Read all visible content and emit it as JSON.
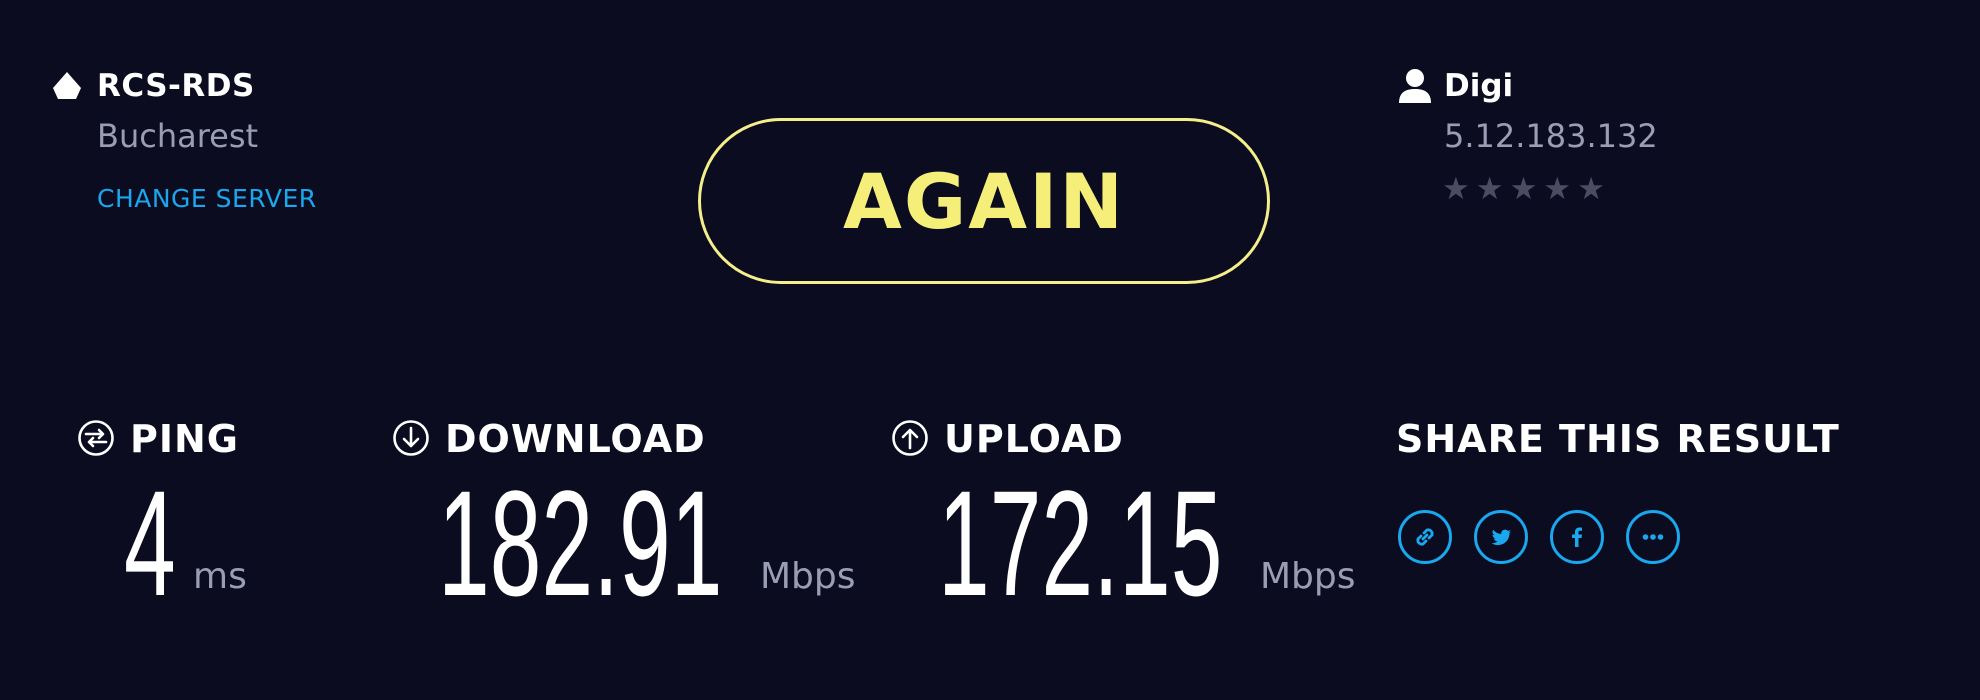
{
  "server": {
    "name": "RCS-RDS",
    "city": "Bucharest",
    "change_label": "CHANGE SERVER",
    "icon": "server-icon"
  },
  "action": {
    "again_label": "AGAIN"
  },
  "isp": {
    "name": "Digi",
    "ip": "5.12.183.132",
    "rating": 0,
    "rating_max": 5,
    "icon": "user-icon"
  },
  "metrics": {
    "ping": {
      "label": "PING",
      "value": "4",
      "unit": "ms",
      "icon": "ping-icon"
    },
    "download": {
      "label": "DOWNLOAD",
      "value": "182.91",
      "unit": "Mbps",
      "icon": "download-icon"
    },
    "upload": {
      "label": "UPLOAD",
      "value": "172.15",
      "unit": "Mbps",
      "icon": "upload-icon"
    }
  },
  "share": {
    "label": "SHARE THIS RESULT",
    "buttons": [
      "link-icon",
      "twitter-icon",
      "facebook-icon",
      "more-icon"
    ]
  },
  "colors": {
    "background": "#0b0c20",
    "accent_yellow": "#f5ef7a",
    "accent_blue": "#1aa7ee",
    "muted_text": "#9a9db4"
  }
}
